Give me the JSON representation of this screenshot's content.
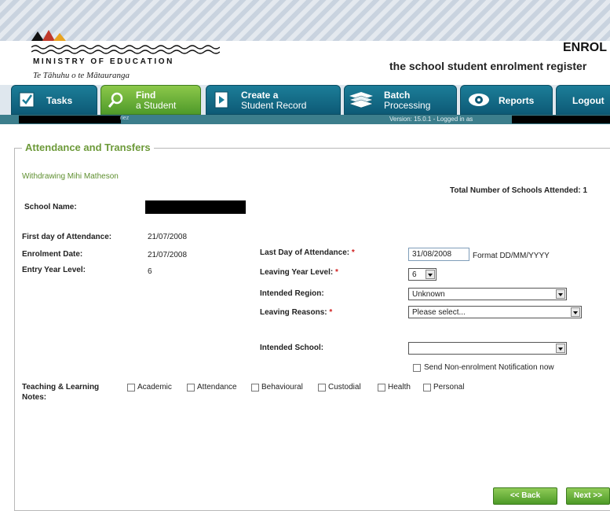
{
  "header": {
    "ministry": "MINISTRY OF EDUCATION",
    "maori": "Te Tāhuhu o te Mātauranga",
    "app_title": "ENROL",
    "app_subtitle": "the school student enrolment register"
  },
  "nav": {
    "tasks": "Tasks",
    "find_l1": "Find",
    "find_l2": "a Student",
    "create_l1": "Create a",
    "create_l2": "Student Record",
    "batch_l1": "Batch",
    "batch_l2": "Processing",
    "reports": "Reports",
    "logout": "Logout"
  },
  "status": {
    "small": "riez",
    "version": "Version: 15.0.1 - Logged in as"
  },
  "section": {
    "legend": "Attendance and Transfers",
    "withdrawing": "Withdrawing Mihi Matheson",
    "total_schools": "Total Number of Schools Attended: 1"
  },
  "form": {
    "school_name_label": "School Name:",
    "first_day_label": "First day of Attendance:",
    "first_day_value": "21/07/2008",
    "enrolment_date_label": "Enrolment Date:",
    "enrolment_date_value": "21/07/2008",
    "entry_level_label": "Entry Year Level:",
    "entry_level_value": "6",
    "last_day_label": "Last Day of Attendance:",
    "last_day_value": "31/08/2008",
    "date_format": "Format DD/MM/YYYY",
    "leaving_level_label": "Leaving Year Level:",
    "leaving_level_value": "6",
    "region_label": "Intended Region:",
    "region_value": "Unknown",
    "reasons_label": "Leaving Reasons:",
    "reasons_value": "Please select...",
    "school_label": "Intended School:",
    "school_value": "",
    "send_notification": "Send Non-enrolment Notification now",
    "required_mark": "*",
    "notes_label_1": "Teaching & Learning",
    "notes_label_2": "Notes:",
    "notes_options": [
      "Academic",
      "Attendance",
      "Behavioural",
      "Custodial",
      "Health",
      "Personal"
    ]
  },
  "buttons": {
    "back": "<< Back",
    "next": "Next >>"
  }
}
